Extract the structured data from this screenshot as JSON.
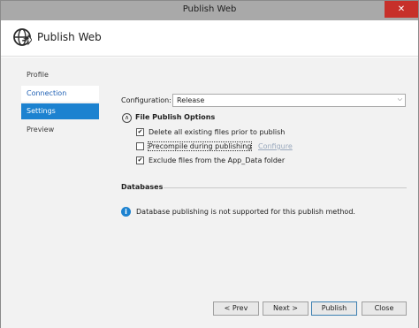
{
  "window": {
    "title": "Publish Web",
    "close_glyph": "✕"
  },
  "header": {
    "title": "Publish Web",
    "icon": "globe-arrow-icon"
  },
  "nav": {
    "profile": "Profile",
    "connection": "Connection",
    "settings": "Settings",
    "preview": "Preview"
  },
  "settings": {
    "config_label": "Configuration:",
    "config_value": "Release",
    "group_title": "File Publish Options",
    "opt_delete": {
      "label": "Delete all existing files prior to publish",
      "checked": true
    },
    "opt_precompile": {
      "label": "Precompile during publishing",
      "checked": false,
      "link": "Configure"
    },
    "opt_exclude": {
      "label": "Exclude files from the App_Data folder",
      "checked": true
    }
  },
  "databases": {
    "title": "Databases",
    "info": "Database publishing is not supported for this publish method."
  },
  "footer": {
    "prev": "< Prev",
    "next": "Next >",
    "publish": "Publish",
    "close": "Close"
  },
  "colors": {
    "accent": "#1c82d0",
    "titlebar": "#a9a9a9",
    "close": "#c7302a",
    "link": "#1f60b4"
  }
}
